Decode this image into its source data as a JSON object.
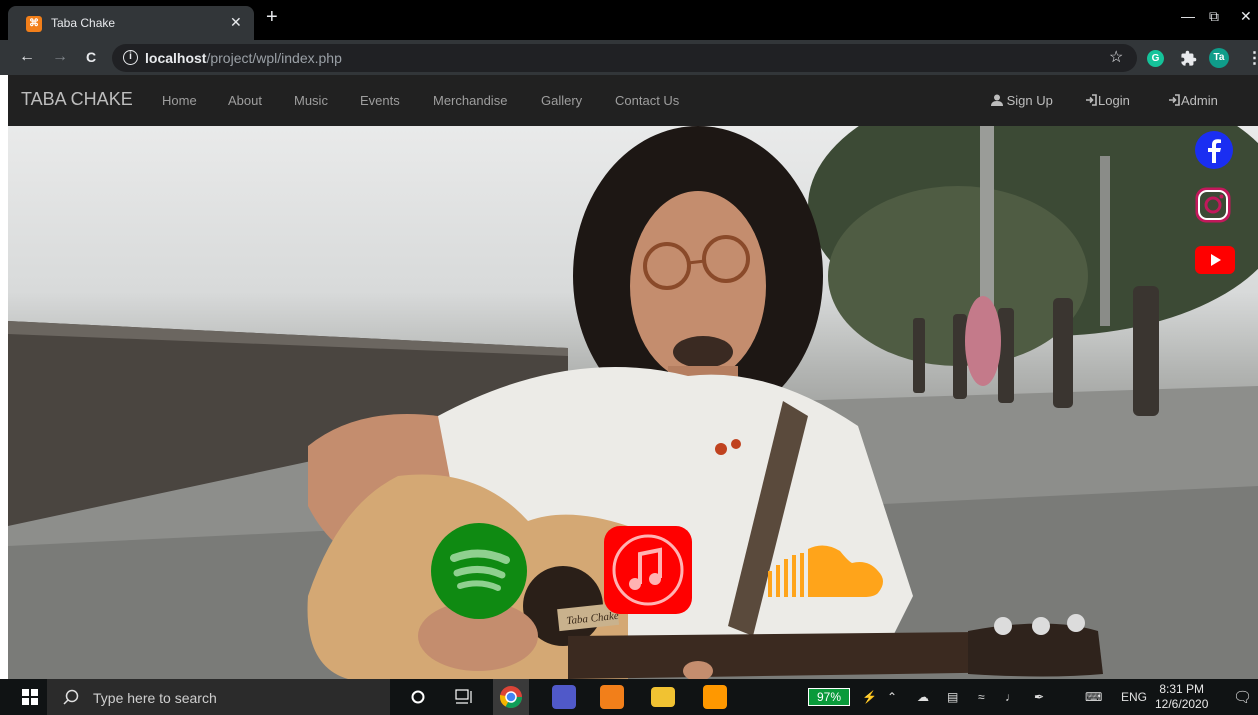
{
  "browser": {
    "tab_title": "Taba Chake",
    "tab_favicon_letter": "⌘",
    "tab_close": "✕",
    "new_tab": "+",
    "back": "←",
    "forward": "→",
    "reload": "C",
    "url_host": "localhost",
    "url_path": "/project/wpl/index.php",
    "star": "☆",
    "ext_grammarly": "G",
    "ext_profile": "Ta",
    "minimize": "—",
    "restore": "⧉",
    "close": "✕"
  },
  "site": {
    "brand": "TABA CHAKE",
    "nav": [
      "Home",
      "About",
      "Music",
      "Events",
      "Merchandise",
      "Gallery",
      "Contact Us"
    ],
    "signup": "Sign Up",
    "login": "Login",
    "admin": "Admin"
  },
  "taskbar": {
    "search_placeholder": "Type here to search",
    "battery": "97%",
    "lang": "ENG",
    "time": "8:31 PM",
    "date": "12/6/2020"
  },
  "colors": {
    "facebook": "#1a2ef2",
    "instagram": "#ffffff",
    "youtube": "#ff0000",
    "spotify": "#0f8a12",
    "apple_music": "#ff0000",
    "soundcloud": "#ffa41a"
  },
  "guitar_label": "Taba Chake"
}
